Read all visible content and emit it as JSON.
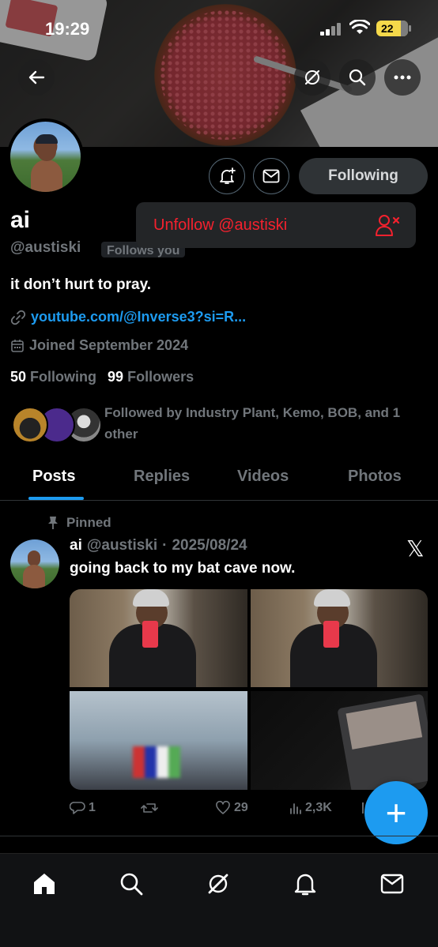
{
  "status_bar": {
    "time": "19:29",
    "battery": "22"
  },
  "header": {
    "back_icon": "arrow-left-icon",
    "grok_icon": "grok-icon",
    "search_icon": "search-icon",
    "more_icon": "more-icon"
  },
  "profile": {
    "name": "ai",
    "handle": "@austiski",
    "follows_you": "Follows you",
    "bio": "it don’t hurt to pray.",
    "link": "youtube.com/@Inverse3?si=R...",
    "joined": "Joined September 2024",
    "following_count": "50",
    "following_label": "Following",
    "followers_count": "99",
    "followers_label": "Followers",
    "followed_by": "Followed by Industry Plant, Kemo, BOB, and 1 other"
  },
  "actions": {
    "following_button": "Following",
    "unfollow_menu": "Unfollow @austiski"
  },
  "tabs": [
    "Posts",
    "Replies",
    "Videos",
    "Photos"
  ],
  "post": {
    "pinned_label": "Pinned",
    "name": "ai",
    "handle": "@austiski",
    "separator": "·",
    "date": "2025/08/24",
    "text": "going back to my bat cave now.",
    "x_logo": "𝕏",
    "replies": "1",
    "likes": "29",
    "views": "2,3K"
  },
  "fab_label": "+",
  "colors": {
    "accent": "#1d9bf0",
    "danger": "#f4212e",
    "muted": "#71767b"
  }
}
